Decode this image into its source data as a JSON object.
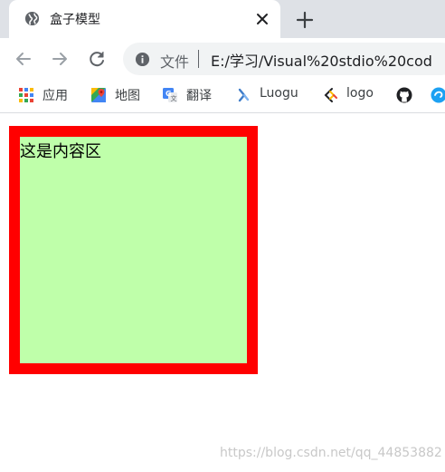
{
  "tab": {
    "title": "盒子模型"
  },
  "toolbar": {
    "security_label": "文件",
    "url": "E:/学习/Visual%20stdio%20cod"
  },
  "bookmarks": [
    {
      "label": "应用",
      "icon": "apps-grid-icon"
    },
    {
      "label": "地图",
      "icon": "maps-icon"
    },
    {
      "label": "翻译",
      "icon": "translate-icon"
    },
    {
      "label": "Luogu",
      "icon": "luogu-icon"
    },
    {
      "label": "logo",
      "icon": "logo-icon"
    },
    {
      "label": "",
      "icon": "github-icon"
    },
    {
      "label": "",
      "icon": "bookmark-blue-icon"
    }
  ],
  "page": {
    "box_text": "这是内容区",
    "watermark": "https://blog.csdn.net/qq_44853882"
  },
  "colors": {
    "box_border": "#ff0000",
    "box_background": "#bfffaa"
  }
}
